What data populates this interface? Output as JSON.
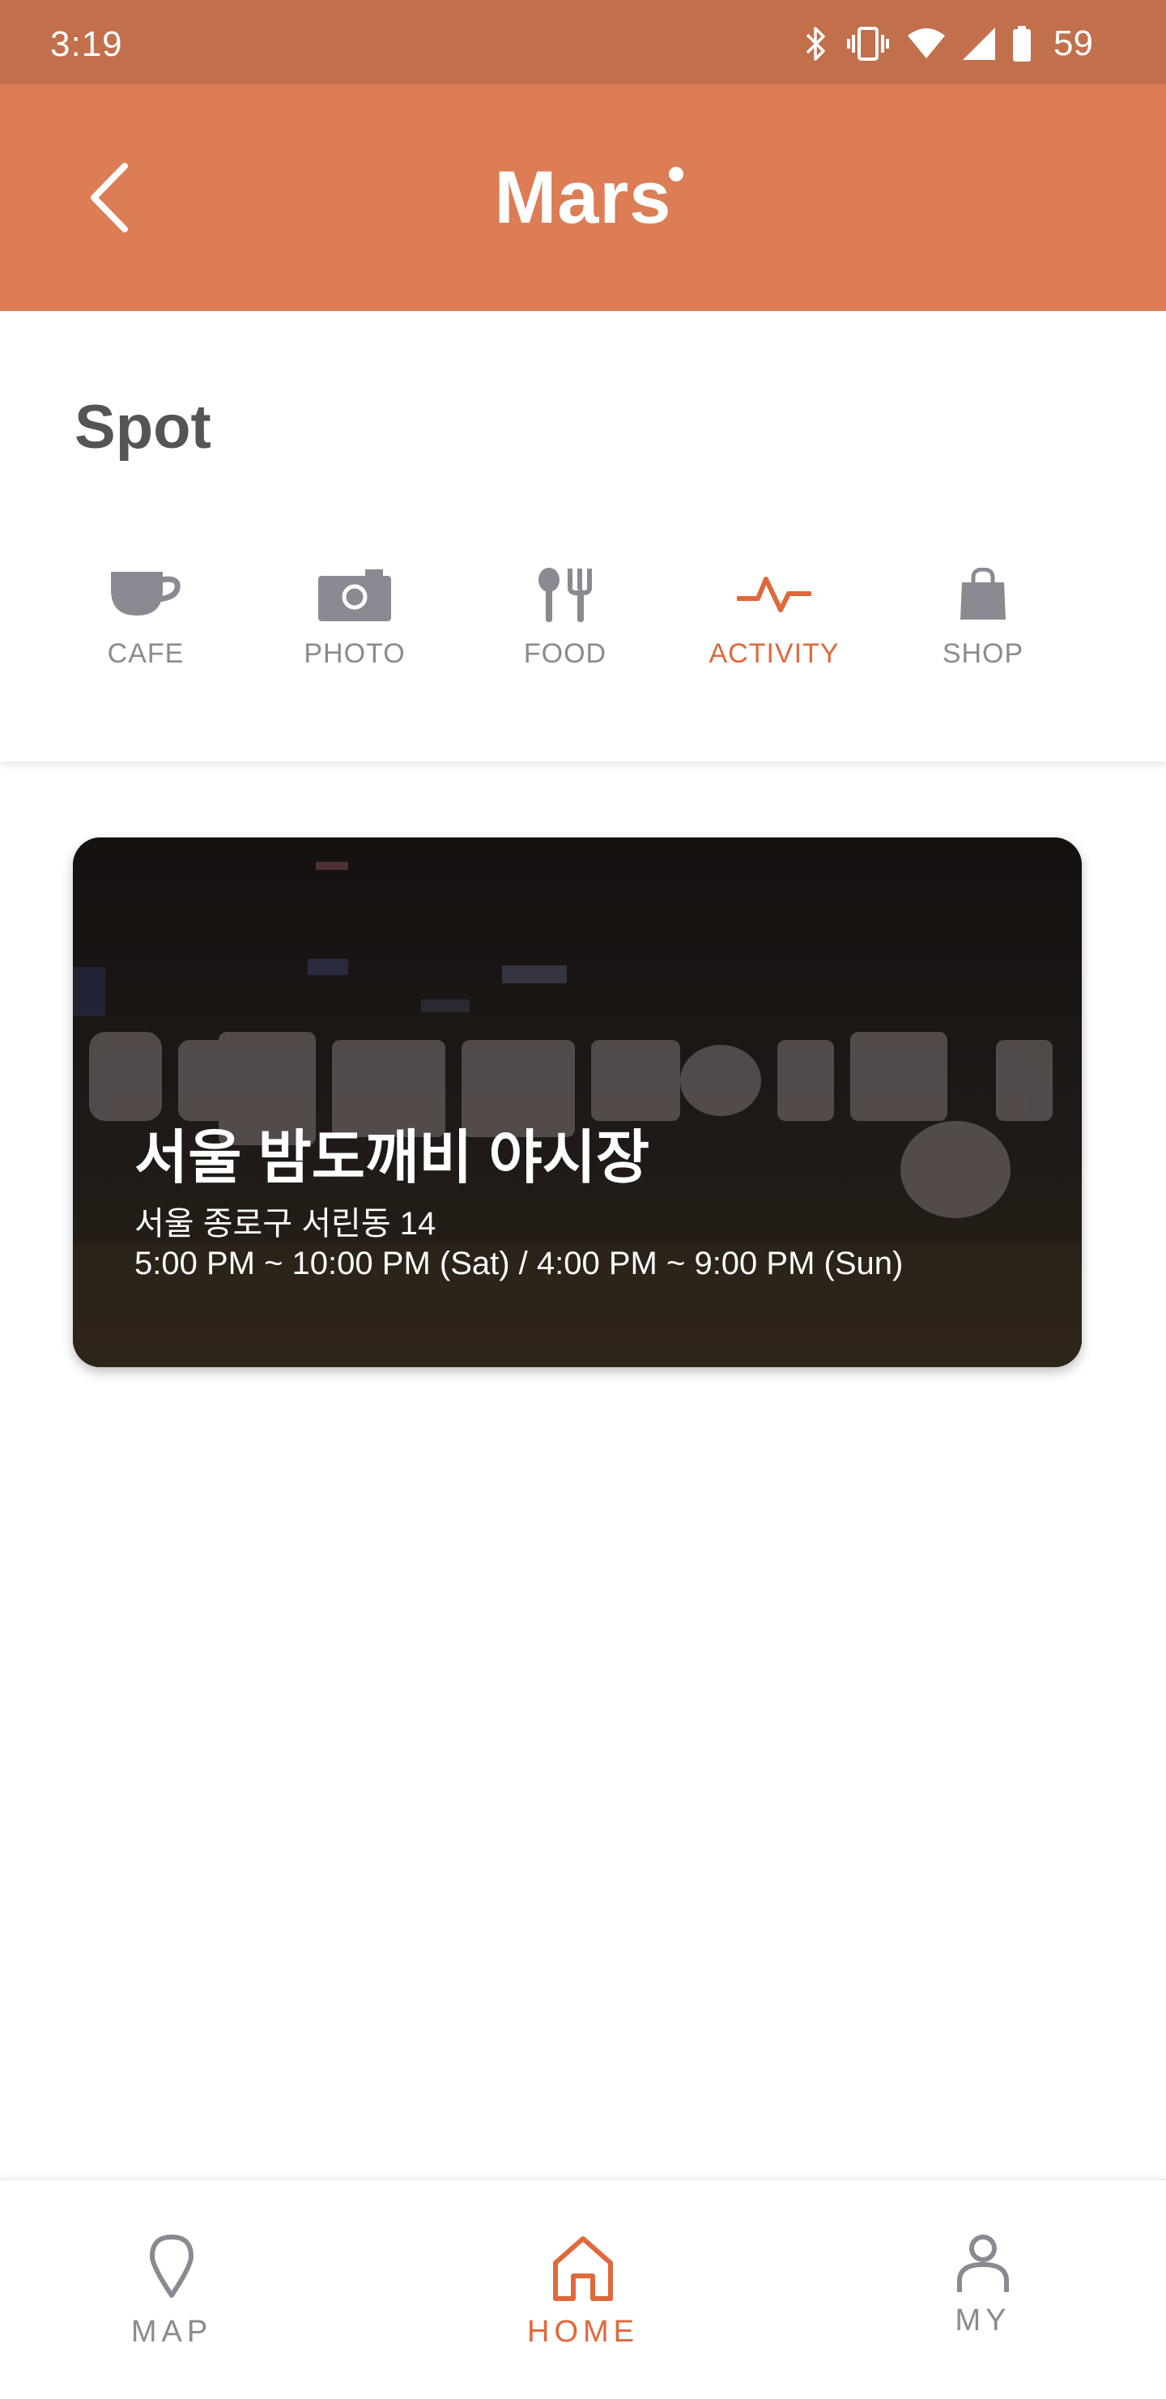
{
  "status_bar": {
    "time": "3:19",
    "battery": "59",
    "icons": [
      "bluetooth-icon",
      "vibrate-icon",
      "wifi-icon",
      "signal-icon",
      "battery-icon"
    ]
  },
  "app_bar": {
    "title": "Mars",
    "back_icon": "back-arrow-icon"
  },
  "spot": {
    "title": "Spot",
    "categories": [
      {
        "label": "CAFE",
        "icon": "coffee-cup-icon",
        "active": false
      },
      {
        "label": "PHOTO",
        "icon": "camera-icon",
        "active": false
      },
      {
        "label": "FOOD",
        "icon": "fork-knife-icon",
        "active": false
      },
      {
        "label": "ACTIVITY",
        "icon": "pulse-icon",
        "active": true
      },
      {
        "label": "SHOP",
        "icon": "shopping-bag-icon",
        "active": false
      }
    ]
  },
  "cards": [
    {
      "title": "서울 밤도깨비 야시장",
      "address": "서울 종로구 서린동 14",
      "hours": "5:00 PM ~ 10:00 PM (Sat) / 4:00 PM ~ 9:00 PM (Sun)",
      "image": "night-market-sign-photo"
    }
  ],
  "bottom_nav": {
    "items": [
      {
        "label": "MAP",
        "icon": "map-pin-icon",
        "active": false
      },
      {
        "label": "HOME",
        "icon": "home-icon",
        "active": true
      },
      {
        "label": "MY",
        "icon": "person-icon",
        "active": false
      }
    ]
  },
  "colors": {
    "status_bar": "#c26f4c",
    "app_bar": "#dc7d55",
    "accent": "#e0683b",
    "inactive": "#8a8a92",
    "heading": "#555555"
  }
}
